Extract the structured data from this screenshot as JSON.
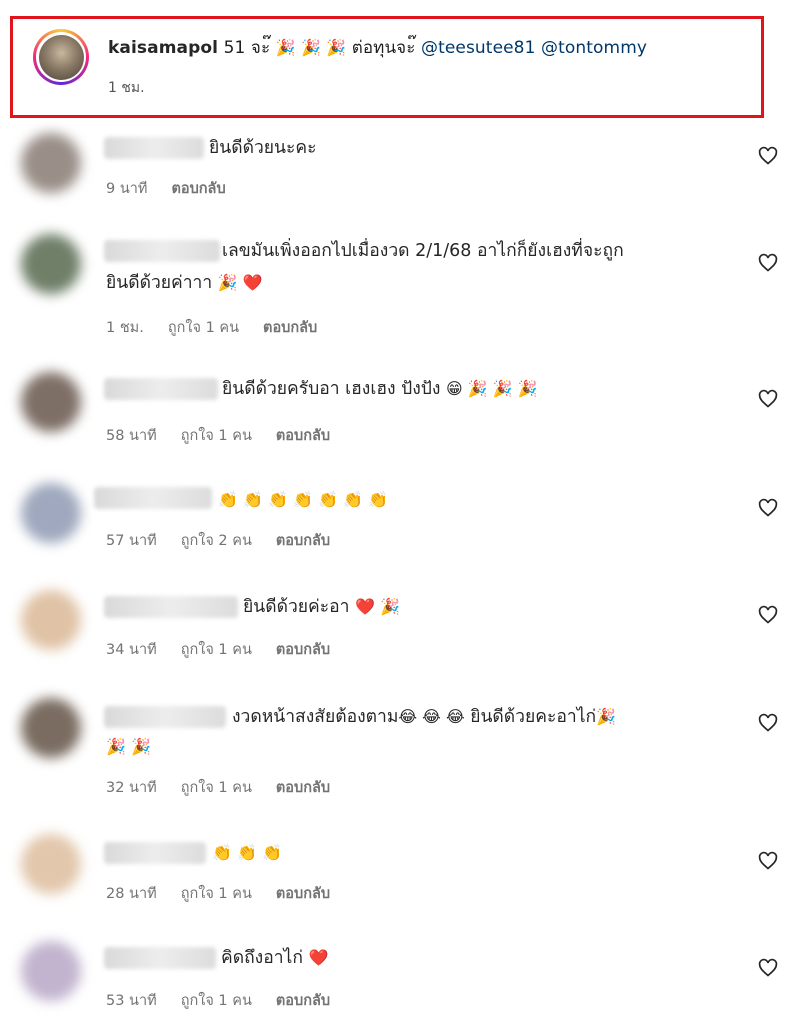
{
  "caption": {
    "username": "kaisamapol",
    "text": "51 จะ๊",
    "emojis": "🎉 🎉 🎉",
    "text2": "ต่อทุนจะ๊",
    "mentions": [
      "@teesutee81",
      "@tontommy"
    ],
    "time": "1 ชม."
  },
  "comments": [
    {
      "text": "ยินดีด้วยนะคะ",
      "time": "9 นาที",
      "likes": "",
      "reply": "ตอบกลับ"
    },
    {
      "text": "เลขมันเพิ่งออกไปเมื่องวด 2/1/68 อาไก่ก็ยังเฮงที่จะถูก",
      "text2": "ยินดีด้วยค่าาา",
      "emojis": "🎉 ❤️",
      "time": "1 ชม.",
      "likes": "ถูกใจ 1 คน",
      "reply": "ตอบกลับ"
    },
    {
      "text": "ยินดีด้วยครับอา เฮงเฮง ปังปัง",
      "emojis": "😁 🎉 🎉 🎉",
      "time": "58 นาที",
      "likes": "ถูกใจ 1 คน",
      "reply": "ตอบกลับ"
    },
    {
      "text": "",
      "emojis": "👏 👏 👏 👏 👏 👏 👏",
      "time": "57 นาที",
      "likes": "ถูกใจ 2 คน",
      "reply": "ตอบกลับ"
    },
    {
      "text": "ยินดีด้วยค่ะอา",
      "emojis": "❤️ 🎉",
      "time": "34 นาที",
      "likes": "ถูกใจ 1 คน",
      "reply": "ตอบกลับ"
    },
    {
      "text": "งวดหน้าสงสัยต้องตาม",
      "emojis": "😂 😂 😂",
      "text2": "ยินดีด้วยคะอาไก่",
      "emojis2": "🎉",
      "emojis3": "🎉 🎉",
      "time": "32 นาที",
      "likes": "ถูกใจ 1 คน",
      "reply": "ตอบกลับ"
    },
    {
      "text": "",
      "emojis": "👏 👏 👏",
      "time": "28 นาที",
      "likes": "ถูกใจ 1 คน",
      "reply": "ตอบกลับ"
    },
    {
      "text": "คิดถึงอาไก่",
      "emojis": "❤️",
      "time": "53 นาที",
      "likes": "ถูกใจ 1 คน",
      "reply": "ตอบกลับ"
    }
  ]
}
